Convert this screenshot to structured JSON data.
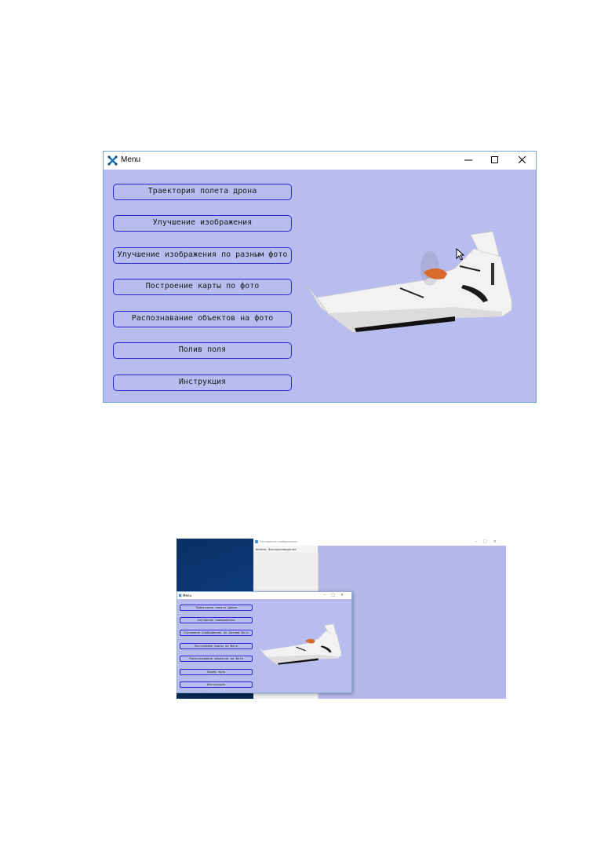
{
  "window": {
    "title": "Menu",
    "icon": "drone-x-icon",
    "controls": [
      "minimize-icon",
      "maximize-icon",
      "close-icon"
    ],
    "background": "#b8bcee",
    "button_border": "#2b2bd6"
  },
  "menu": {
    "items": [
      "Траектория полета дрона",
      "Улучшение изображения",
      "Улучшение изображения по разным фото",
      "Построение карты по фото",
      "Распознавание объектов на фото",
      "Полив поля",
      "Инструкция"
    ]
  },
  "second_screenshot": {
    "background_window": {
      "title": "Построение изображения",
      "menu": [
        "Файлы",
        "Воспроизведение"
      ]
    },
    "menu_window": {
      "title": "Menu",
      "items": [
        "Траектория полета дрона",
        "Улучшение изображения",
        "Улучшение изображения по разным фото",
        "Построение карты по фото",
        "Распознавание объектов на фото",
        "Полив поля",
        "Инструкция"
      ]
    }
  }
}
